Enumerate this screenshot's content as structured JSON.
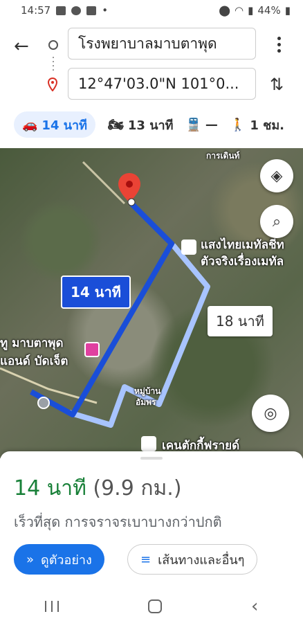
{
  "status_bar": {
    "time": "14:57",
    "battery": "44%"
  },
  "header": {
    "origin_value": "โรงพยาบาลมาบตาพุด",
    "destination_value": "12°47'03.0\"N 101°0...",
    "modes": [
      {
        "icon": "car-icon",
        "label": "14 นาที",
        "active": true
      },
      {
        "icon": "motorcycle-icon",
        "label": "13 นาที",
        "active": false
      },
      {
        "icon": "transit-icon",
        "label": "—",
        "active": false
      },
      {
        "icon": "walk-icon",
        "label": "1 ชม.",
        "active": false
      }
    ]
  },
  "map": {
    "labels": {
      "top_right": "การเดินท์",
      "poi_1_line1": "แสงไทยเมทัลชีท",
      "poi_1_line2": "ตัวจริงเรื่องเมทัล",
      "poi_2_line1": "ทู มาบตาพุด",
      "poi_2_line2": "แอนด์ บัดเจ็ต",
      "village_line1": "หมู่บ้าน",
      "village_line2": "อัมพร",
      "kfc": "เคนตักกี้ฟรายด์"
    },
    "route_fast_label": "14 นาที",
    "route_alt_label": "18 นาที",
    "colors": {
      "route_fast": "#1a4ed8",
      "route_alt": "#a8c4ff"
    }
  },
  "sheet": {
    "eta": "14 นาที",
    "distance": "(9.9 กม.)",
    "subtitle": "เร็วที่สุด การจราจรเบาบางกว่าปกติ",
    "preview_button": "ดูตัวอย่าง",
    "steps_button": "เส้นทางและอื่นๆ"
  }
}
